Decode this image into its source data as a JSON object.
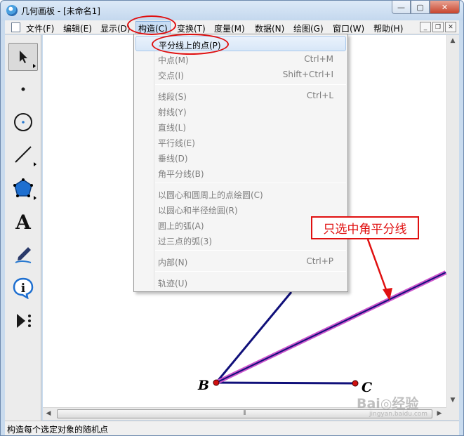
{
  "window": {
    "title": "几何画板 - [未命名1]",
    "minimize_glyph": "—",
    "maximize_glyph": "▢",
    "close_glyph": "✕"
  },
  "menubar": {
    "items": [
      "文件(F)",
      "编辑(E)",
      "显示(D)",
      "构造(C)",
      "变换(T)",
      "度量(M)",
      "数据(N)",
      "绘图(G)",
      "窗口(W)",
      "帮助(H)"
    ],
    "open_item": "构造(C)",
    "mdi_glyphs": [
      "_",
      "❐",
      "✕"
    ]
  },
  "toolbox": {
    "tools": [
      "arrow-select-icon",
      "point-icon",
      "compass-icon",
      "straightedge-icon",
      "polygon-icon",
      "text-icon",
      "marker-icon",
      "info-icon",
      "custom-tool-icon"
    ],
    "text_tool_glyph": "A",
    "info_glyph": "i"
  },
  "construct_menu": {
    "groups": [
      [
        {
          "label": "平分线上的点(P)",
          "shortcut": "",
          "enabled": true,
          "hover": true
        },
        {
          "label": "中点(M)",
          "shortcut": "Ctrl+M",
          "enabled": false
        },
        {
          "label": "交点(I)",
          "shortcut": "Shift+Ctrl+I",
          "enabled": false
        }
      ],
      [
        {
          "label": "线段(S)",
          "shortcut": "Ctrl+L",
          "enabled": false
        },
        {
          "label": "射线(Y)",
          "shortcut": "",
          "enabled": false
        },
        {
          "label": "直线(L)",
          "shortcut": "",
          "enabled": false
        },
        {
          "label": "平行线(E)",
          "shortcut": "",
          "enabled": false
        },
        {
          "label": "垂线(D)",
          "shortcut": "",
          "enabled": false
        },
        {
          "label": "角平分线(B)",
          "shortcut": "",
          "enabled": false
        }
      ],
      [
        {
          "label": "以圆心和圆周上的点绘圆(C)",
          "shortcut": "",
          "enabled": false
        },
        {
          "label": "以圆心和半径绘圆(R)",
          "shortcut": "",
          "enabled": false
        },
        {
          "label": "圆上的弧(A)",
          "shortcut": "",
          "enabled": false
        },
        {
          "label": "过三点的弧(3)",
          "shortcut": "",
          "enabled": false
        }
      ],
      [
        {
          "label": "内部(N)",
          "shortcut": "Ctrl+P",
          "enabled": false
        }
      ],
      [
        {
          "label": "轨迹(U)",
          "shortcut": "",
          "enabled": false
        }
      ]
    ]
  },
  "canvas": {
    "point_labels": {
      "B": "B",
      "C": "C"
    },
    "colors": {
      "segment": "#10107a",
      "bisector": "#10107a",
      "bisector_highlight": "#cc55cc",
      "point": "#d01010"
    }
  },
  "annotation": {
    "callout_text": "只选中角平分线",
    "color": "#e01010"
  },
  "scrollbar": {
    "grip": "⦀"
  },
  "watermark": {
    "text": "Bai◎经验",
    "sub": "jingyan.baidu.com"
  },
  "statusbar": {
    "text": "构造每个选定对象的随机点"
  }
}
